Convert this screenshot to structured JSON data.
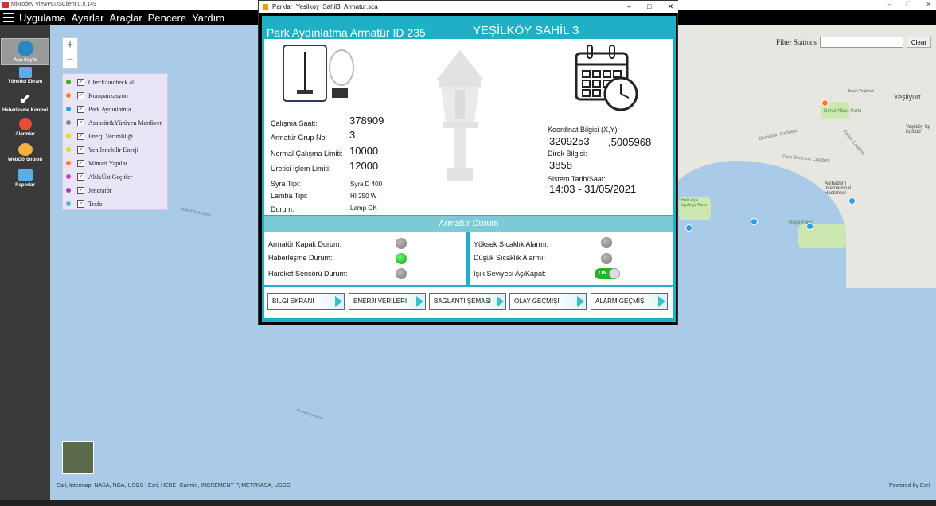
{
  "app": {
    "title": "Mikrodev ViewPLUSClient 0.9.149",
    "menu": [
      "Uygulama",
      "Ayarlar",
      "Araçlar",
      "Pencere",
      "Yardım"
    ]
  },
  "sidebar": [
    {
      "label": "Ana Sayfa",
      "icon": "globe-icon",
      "color": "#2e86c1"
    },
    {
      "label": "Yönetici Ekranı",
      "icon": "flag-icon",
      "color": "#5dade2"
    },
    {
      "label": "Haberleşme Kontrol",
      "icon": "checkmark-icon",
      "color": "#ffffff"
    },
    {
      "label": "Alarmlar",
      "icon": "siren-icon",
      "color": "#e74c3c"
    },
    {
      "label": "WebGörünümü",
      "icon": "cloud-icon",
      "color": "#f5b041"
    },
    {
      "label": "Raporlar",
      "icon": "monitor-icon",
      "color": "#5dade2"
    }
  ],
  "map": {
    "zoom_in": "+",
    "zoom_out": "−",
    "filter_label": "Filter Stations",
    "filter_placeholder": "",
    "filter_button": "Clear",
    "attribution": "Esri, Intermap, NASA, NGA, USGS | Esri, HERE, Garmin, INCREMENT P, METI/NASA, USGS",
    "powered": "Powered by Esri",
    "layers": [
      {
        "label": "Check/uncheck all",
        "color": "#3bb300"
      },
      {
        "label": "Kompanzasyon",
        "color": "#ff7f27"
      },
      {
        "label": "Park Aydınlatma",
        "color": "#2e9fe0"
      },
      {
        "label": "Asansör&Yürüyen Merdiven",
        "color": "#888888"
      },
      {
        "label": "Enerji Verimliliği",
        "color": "#e0e000"
      },
      {
        "label": "Yenilenebilir Enerji",
        "color": "#e0e000"
      },
      {
        "label": "Mimari Yapılar",
        "color": "#ff7f27"
      },
      {
        "label": "Alt&Üst Geçitler",
        "color": "#c040c0"
      },
      {
        "label": "Jeneratör",
        "color": "#a040c0"
      },
      {
        "label": "Trafo",
        "color": "#40c0e0"
      }
    ],
    "places": [
      "Yeşilyurt",
      "Deniz Altası Parkı",
      "Acıbadem International Hastanesi",
      "Rüya Parkı",
      "Halit Ziya Uşaklıgil Parkı",
      "Gazi Evrenos Caddesi",
      "Demirjolu Caddesi",
      "Yeşilköy Sp Kulübü",
      "Bakırköy Ayvancı",
      "Avcılar Ayvancı",
      "Fener Caddesi",
      "Basın Yeşilyurt"
    ]
  },
  "dialog": {
    "window_title": "Parklar_Yesilkoy_Sahil3_Armatur.sca",
    "controls": [
      "–",
      "□",
      "✕"
    ],
    "header_left": "Park Aydınlatma Armatür ID 235",
    "header_right": "YEŞİLKÖY SAHİL 3",
    "fields": {
      "calisma_saati": {
        "label": "Çalışma Saati:",
        "value": "378909"
      },
      "grup_no": {
        "label": "Armatür Grup No:",
        "value": "3"
      },
      "normal_limit": {
        "label": "Normal Çalışma Limiti:",
        "value": "10000"
      },
      "uretici_limit": {
        "label": "Üretici İşlem Limiti:",
        "value": "12000"
      },
      "syra_tipi": {
        "label": "Syra Tipi:",
        "value": "Syra D 400"
      },
      "lamba_tipi": {
        "label": "Lamba Tipi:",
        "value": "HI 250 W"
      },
      "durum": {
        "label": "Durum:",
        "value": "Lamp OK"
      },
      "koordinat": {
        "label": "Koordinat Bilgisi (X,Y):",
        "x": "3209253",
        "y": ",5005968"
      },
      "direk": {
        "label": "Direk Bilgisi:",
        "value": "3858"
      },
      "tarih": {
        "label": "Sistem Tarih/Saat:",
        "value": "14:03 - 31/05/2021"
      }
    },
    "status_title": "Armatür Durum",
    "status_left": [
      {
        "label": "Armatür Kapak Durum:",
        "state": "off"
      },
      {
        "label": "Haberleşme Durum:",
        "state": "on"
      },
      {
        "label": "Hareket Sensörü Durum:",
        "state": "off"
      }
    ],
    "status_right": [
      {
        "label": "Yüksek Sıcaklık Alarmı:",
        "state": "off"
      },
      {
        "label": "Düşük Sıcaklık Alarmı:",
        "state": "off"
      },
      {
        "label": "Işık Seviyesi Aç/Kapat:",
        "toggle": "ON"
      }
    ],
    "buttons": [
      "BİLGİ EKRANI",
      "ENERJİ VERİLERİ",
      "BAĞLANTI ŞEMASI",
      "OLAY GEÇMİŞİ",
      "ALARM GEÇMİŞİ"
    ]
  }
}
